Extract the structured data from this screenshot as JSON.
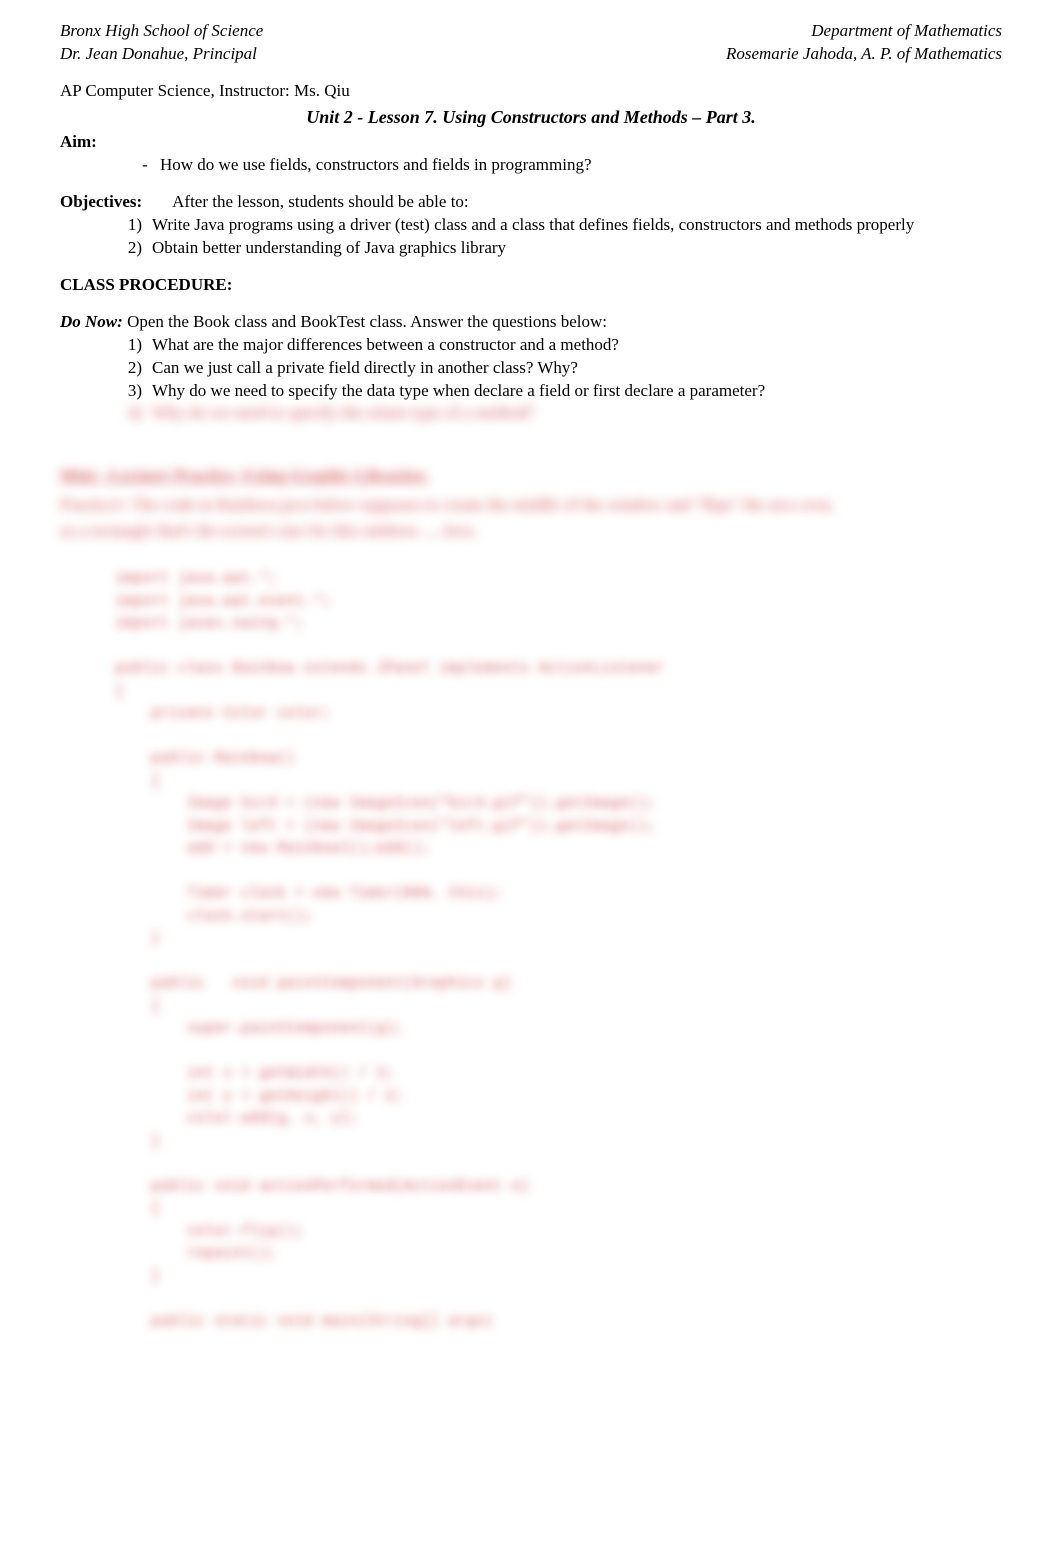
{
  "header": {
    "school": "Bronx High School of Science",
    "department": "Department of Mathematics",
    "principal": "Dr. Jean Donahue, Principal",
    "ap": "Rosemarie Jahoda, A. P. of Mathematics"
  },
  "course": {
    "instructor_line": "AP Computer Science, Instructor: Ms. Qiu",
    "unit_title": "Unit 2 - Lesson 7. Using Constructors and Methods – Part 3."
  },
  "aim": {
    "label": "Aim:",
    "items": [
      "How do we use fields, constructors and fields in programming?"
    ]
  },
  "objectives": {
    "label": "Objectives:",
    "intro": "After the lesson, students should be able to:",
    "items": [
      "Write Java programs using a driver (test) class and a class that defines fields, constructors and methods properly",
      "Obtain better understanding of Java graphics library"
    ]
  },
  "class_procedure": {
    "label": "CLASS PROCEDURE:"
  },
  "donow": {
    "label": "Do Now:",
    "text": " Open the Book class and BookTest class.  Answer the questions below:",
    "items": [
      "What are the major differences between a constructor and a method?",
      "Can we just call a private field directly in another class? Why?",
      "Why do we need to specify the data type when declare a field or first declare a parameter?",
      "Why do we need to specify the return type of a method?"
    ]
  },
  "blurred": {
    "heading": "Mini - Lecture/ Practice -Using Graphic Libraries:",
    "para1": "Practice1:   The code in Rainbow.java below supposes to   create the middle of the window and \"flips\" the arcs over,",
    "para2": "as a rectangle that's the screen's size for this  rainbow. ...  Java.",
    "code": "import java.awt.*;\nimport java.awt.event.*;\nimport javax.swing.*;\n\npublic class Rainbow extends JPanel implements ActionListener\n{\n    private Color color;\n\n    public Rainbow()\n    {\n        Image bird = (new ImageIcon(\"bird.gif\")).getImage();\n        Image left = (new ImageIcon(\"left.gif\")).getImage();\n        add = new Rainbowl();add();\n\n        Timer clock = new Timer(800, this);\n        clock.start();\n    }\n\n    public   void paintComponent(Graphics g)\n    {\n        super.paintComponent(g);\n\n        int x = getWidth() / 2;\n        int y = getHeight() / 2;\n        color.add(g, x, y);\n    }\n\n    public void actionPerformed(ActionEvent e)\n    {\n        color.flip();\n        repaint();\n    }\n\n    public static void main(String[] args)"
  }
}
